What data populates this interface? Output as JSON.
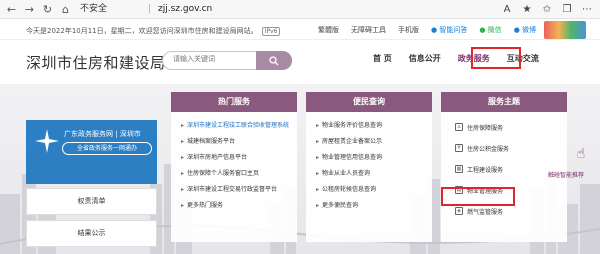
{
  "browser": {
    "security_label": "不安全",
    "url": "zjj.sz.gov.cn",
    "buttons": [
      "←",
      "→",
      "↻",
      "⌂"
    ],
    "toolbar_icons": [
      "A",
      "★",
      "✩",
      "❐",
      "⋯"
    ]
  },
  "topbar": {
    "date_text": "今天是2022年10月11日，星期二，欢迎您访问深圳市住房和建设局网站。",
    "ipv6": "IPv6",
    "links": [
      "繁體版",
      "无障碍工具",
      "手机版",
      "● 智能问答",
      "● 微信",
      "● 微博"
    ]
  },
  "header": {
    "site_title": "深圳市住房和建设局",
    "search_placeholder": "请输入关键词",
    "nav": [
      "首 页",
      "信息公开",
      "政务服务",
      "互动交流"
    ],
    "active_nav_index": 2
  },
  "left_panel": {
    "card_title": "广东政务服务网 | 深圳市",
    "card_button": "全省政务服务一网通办",
    "buttons": [
      "权责清单",
      "结果公示"
    ]
  },
  "columns": [
    {
      "title": "热门服务",
      "items": [
        "深圳市建设工程竣工联合验收管理系统",
        "城建档案服务平台",
        "深圳市房地产信息平台",
        "住房保障个人服务窗口主页",
        "深圳市建设工程交易行政监督平台",
        "更多热门服务"
      ],
      "highlight_index": 0
    },
    {
      "title": "便民查询",
      "items": [
        "物业服务评价信息查询",
        "房屋租赁企业备案公示",
        "物业管理信用信息查询",
        "物业从业人员查询",
        "公租房轮候信息查询",
        "更多便民查询"
      ],
      "highlight_index": -1
    }
  ],
  "themes": {
    "title": "服务主题",
    "items": [
      "住房保障服务",
      "住房公积金服务",
      "工程建设服务",
      "物业管理服务",
      "燃气监管服务"
    ],
    "highlight_index": 3
  },
  "assistant": {
    "label": "触碰智能推荐"
  }
}
